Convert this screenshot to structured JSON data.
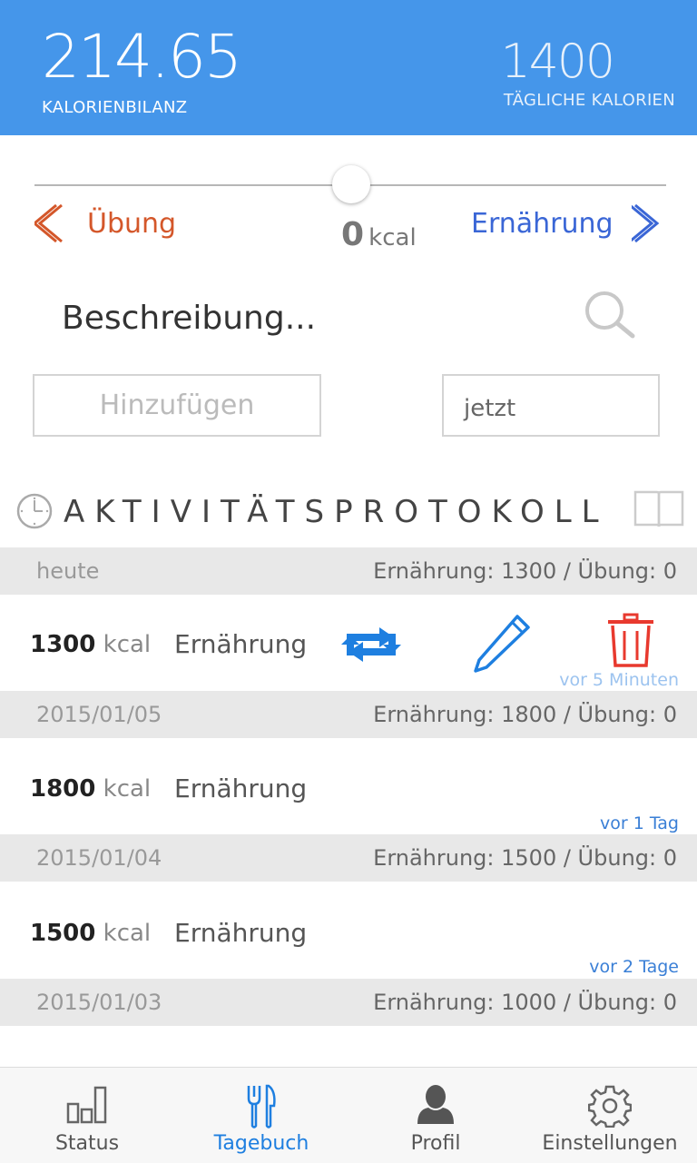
{
  "header": {
    "balance_value": "214.65",
    "balance_label": "KALORIENBILANZ",
    "daily_value": "1400",
    "daily_label": "TÄGLICHE KALORIEN"
  },
  "slider": {
    "left_label": "Übung",
    "right_label": "Ernährung",
    "value": "0",
    "unit": "kcal",
    "position": 0.5
  },
  "input": {
    "description_placeholder": "Beschreibung...",
    "add_button": "Hinzufügen",
    "time_value": "jetzt"
  },
  "log": {
    "title": "AKTIVITÄTSPROTOKOLL",
    "groups": [
      {
        "date": "heute",
        "summary": "Ernährung: 1300 / Übung: 0",
        "entry": {
          "kcal": "1300",
          "unit": "kcal",
          "type": "Ernährung",
          "ago": "vor 5 Minuten"
        }
      },
      {
        "date": "2015/01/05",
        "summary": "Ernährung: 1800 / Übung: 0",
        "entry": {
          "kcal": "1800",
          "unit": "kcal",
          "type": "Ernährung",
          "ago": "vor 1 Tag"
        }
      },
      {
        "date": "2015/01/04",
        "summary": "Ernährung: 1500 / Übung: 0",
        "entry": {
          "kcal": "1500",
          "unit": "kcal",
          "type": "Ernährung",
          "ago": "vor 2 Tage"
        }
      },
      {
        "date": "2015/01/03",
        "summary": "Ernährung: 1000 / Übung: 0"
      }
    ]
  },
  "nav": {
    "tabs": [
      {
        "label": "Status",
        "icon": "bar-chart-icon"
      },
      {
        "label": "Tagebuch",
        "icon": "fork-knife-icon",
        "active": true
      },
      {
        "label": "Profil",
        "icon": "person-icon"
      },
      {
        "label": "Einstellungen",
        "icon": "gear-icon"
      }
    ]
  },
  "colors": {
    "header_bg": "#4596ea",
    "exercise": "#d4572a",
    "nutrition": "#3a66d6",
    "accent": "#1e7fe0",
    "delete": "#e8392e"
  }
}
